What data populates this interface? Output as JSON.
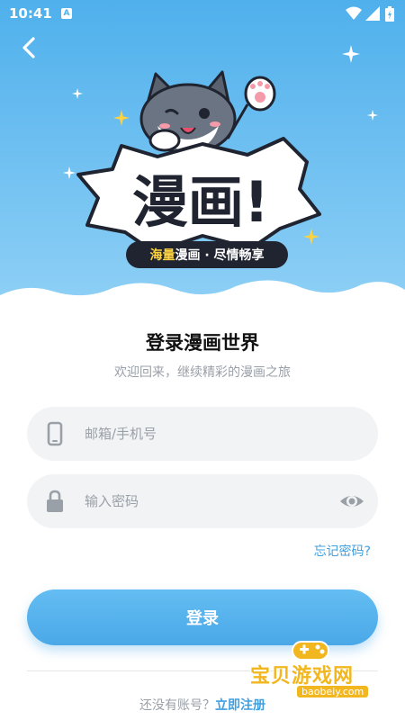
{
  "status_bar": {
    "time": "10:41",
    "badge": "A"
  },
  "logo": {
    "title": "漫画!",
    "tagline_highlight": "海量",
    "tagline_rest": "漫画 · 尽情畅享"
  },
  "login": {
    "title": "登录漫画世界",
    "subtitle": "欢迎回来，继续精彩的漫画之旅",
    "account_placeholder": "邮箱/手机号",
    "password_placeholder": "输入密码",
    "forgot_label": "忘记密码?",
    "submit_label": "登录",
    "no_account_text": "还没有账号？",
    "register_label": "立即注册"
  },
  "watermark": {
    "name": "宝贝游戏网",
    "url": "baobeiy.com"
  },
  "colors": {
    "accent": "#4aa8e8",
    "link": "#3fa0e0",
    "hero_top": "#4fb0ec",
    "pill": "#1f2430",
    "highlight": "#ffd23f"
  },
  "icons": [
    "back-icon",
    "phone-icon",
    "lock-icon",
    "eye-icon",
    "wifi-icon",
    "signal-icon",
    "battery-icon",
    "sparkle-icon"
  ]
}
